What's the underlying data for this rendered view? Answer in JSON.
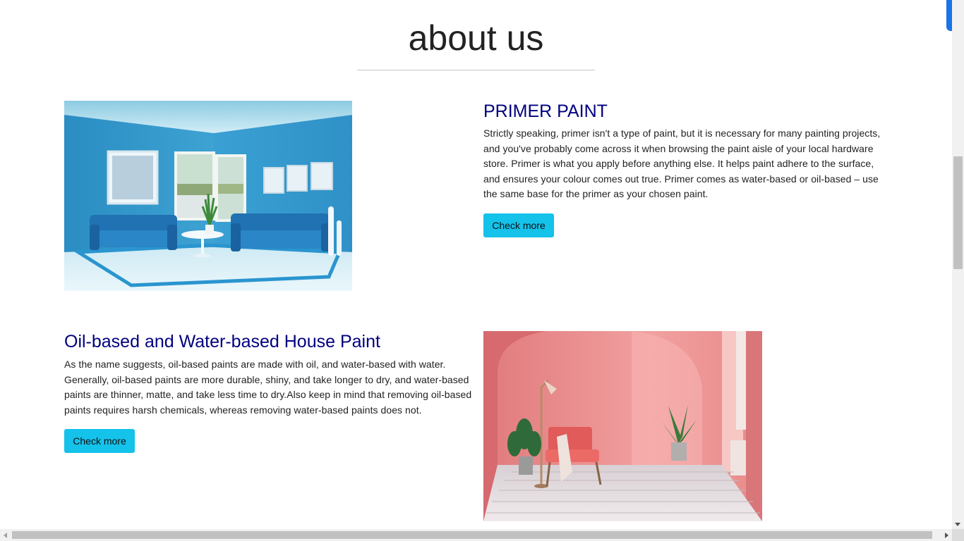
{
  "about": {
    "heading": "about us"
  },
  "sections": [
    {
      "title": "PRIMER PAINT",
      "body": "Strictly speaking, primer isn't a type of paint, but it is necessary for many painting projects, and you've probably come across it when browsing the paint aisle of your local hardware store. Primer is what you apply before anything else. It helps paint adhere to the surface, and ensures your colour comes out true. Primer comes as water-based or oil-based – use the same base for the primer as your chosen paint.",
      "button_label": "Check more"
    },
    {
      "title": "Oil-based and Water-based House Paint",
      "body": "As the name suggests, oil-based paints are made with oil, and water-based with water. Generally, oil-based paints are more durable, shiny, and take longer to dry, and water-based paints are thinner, matte, and take less time to dry.Also keep in mind that removing oil-based paints requires harsh chemicals, whereas removing water-based paints does not.",
      "button_label": "Check more"
    }
  ],
  "colors": {
    "title": "#000080",
    "button": "#14c2ea",
    "scroll_accent": "#1a73e8"
  }
}
